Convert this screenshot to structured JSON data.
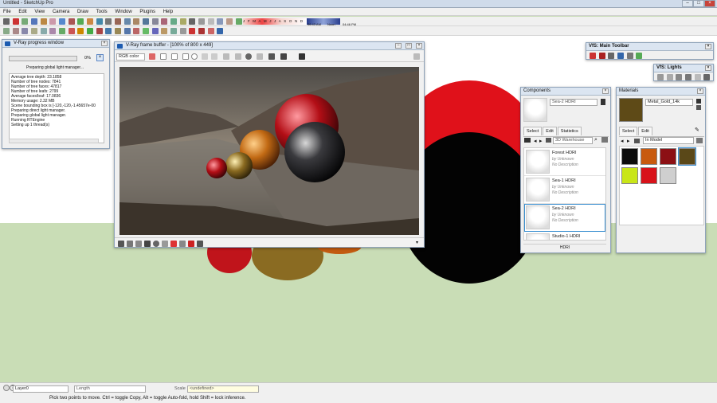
{
  "app": {
    "title": "Untitled - SketchUp Pro",
    "menu": [
      "File",
      "Edit",
      "View",
      "Camera",
      "Draw",
      "Tools",
      "Window",
      "Plugins",
      "Help"
    ]
  },
  "toolbar": {
    "sun_scale": "J F M A M J J A S O N D",
    "time_start": "06:43 AM",
    "time_noon": "Noon",
    "time_end": "04:46 PM"
  },
  "progress": {
    "title": "V-Ray progress window",
    "percent": "0%",
    "status": "Preparing global light manager...",
    "log": [
      "Average tree depth: 23.1858",
      "Number of tree nodes: 7841",
      "Number of tree faces: 47817",
      "Number of tree leafs: 2799",
      "Average faces/leaf: 17.0836",
      "Memory usage: 2.32 MB",
      "Scene bounding box is [-120,-120,-1.45657e-00",
      "Preparing direct light manager.",
      "Preparing global light manager.",
      "Running RTEngine",
      "Setting up 1 thread(s)"
    ]
  },
  "framebuffer": {
    "title": "V-Ray frame buffer - [100% of 800 x 449]",
    "channel": "RGB color"
  },
  "components": {
    "title": "Components",
    "selected_name": "Sea-2 HDRI",
    "tabs": [
      "Select",
      "Edit",
      "Statistics"
    ],
    "search_placeholder": "3D Warehouse",
    "items": [
      {
        "name": "Forest HDRI",
        "by": "by Unknown",
        "desc": "No Description"
      },
      {
        "name": "Sea-1 HDRI",
        "by": "by Unknown",
        "desc": "No Description"
      },
      {
        "name": "Sea-2 HDRI",
        "by": "by Unknown",
        "desc": "No Description"
      },
      {
        "name": "Studio-1 HDRI",
        "by": "",
        "": ""
      }
    ],
    "footer": "HDRI"
  },
  "materials": {
    "title": "Materials",
    "selected_name": "Metal_Gold_14k",
    "tabs": [
      "Select",
      "Edit"
    ],
    "collection": "In Model",
    "swatches": [
      "#0b0b0b",
      "#c85a0f",
      "#8c1014",
      "#5a4818",
      "#c9e617",
      "#d8121a",
      "#cfcfcf"
    ]
  },
  "vfs_toolbar": {
    "title": "VfS: Main Toolbar"
  },
  "vfs_lights": {
    "title": "VfS: Lights"
  },
  "status": {
    "layer_label": "Layer0",
    "length_label": "Length",
    "scale_label": "Scale",
    "scale_value": "<undefined>",
    "hint": "Pick two points to move.  Ctrl = toggle Copy, Alt = toggle Auto-fold, hold Shift = lock inference."
  }
}
